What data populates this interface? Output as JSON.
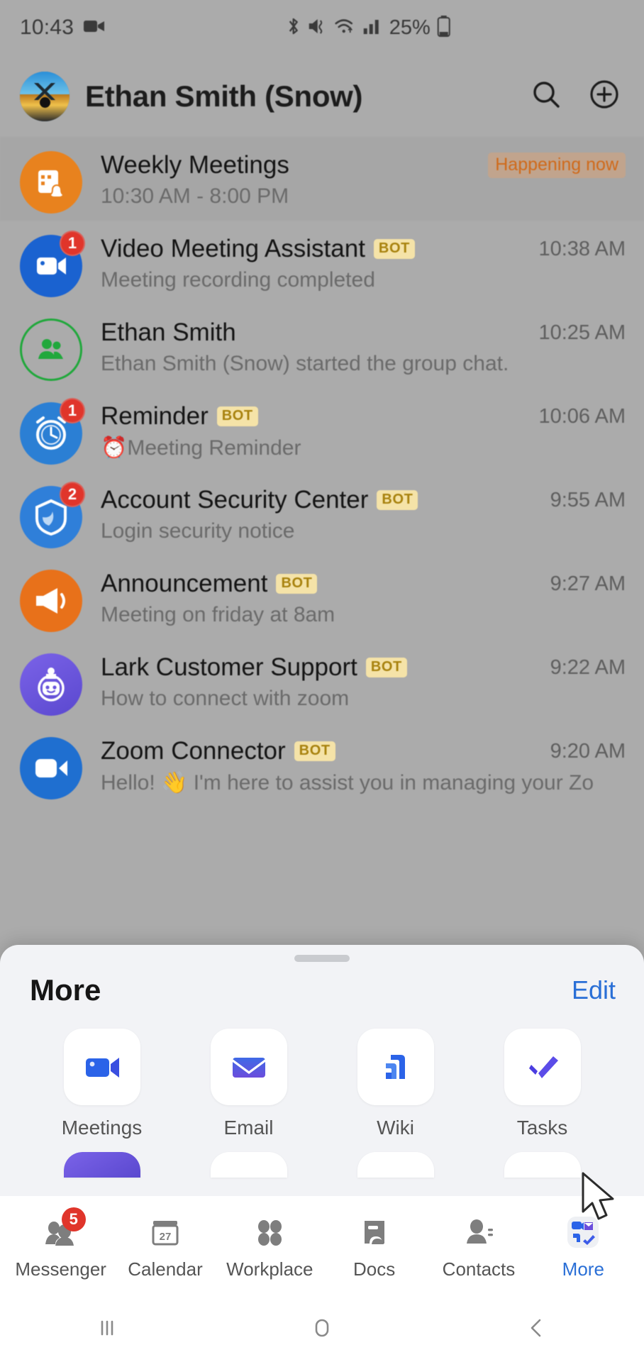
{
  "status_bar": {
    "time": "10:43",
    "battery_percent": "25%",
    "icons": [
      "screen-record-icon",
      "bluetooth-icon",
      "mute-vibrate-icon",
      "wifi-icon",
      "cellular-signal-icon",
      "battery-icon"
    ]
  },
  "header": {
    "title": "Ethan Smith (Snow)",
    "avatar_name": "user-avatar",
    "search_label": "search-icon",
    "add_label": "add-icon"
  },
  "chats": [
    {
      "name": "Weekly Meetings",
      "preview": "10:30 AM - 8:00 PM",
      "status": "Happening now",
      "time": "",
      "bot": false,
      "badge": "",
      "avatar": "calendar-bell-icon",
      "avatar_class": "orange",
      "highlight": true
    },
    {
      "name": "Video Meeting Assistant",
      "preview": "Meeting recording completed",
      "status": "",
      "time": "10:38 AM",
      "bot": true,
      "badge": "1",
      "avatar": "video-camera-icon",
      "avatar_class": "blue",
      "highlight": false
    },
    {
      "name": "Ethan Smith",
      "preview": "Ethan Smith (Snow) started the group chat.",
      "status": "",
      "time": "10:25 AM",
      "bot": false,
      "badge": "",
      "avatar": "group-people-icon",
      "avatar_class": "ring",
      "highlight": false
    },
    {
      "name": "Reminder",
      "preview": "⏰Meeting Reminder",
      "status": "",
      "time": "10:06 AM",
      "bot": true,
      "badge": "1",
      "avatar": "alarm-clock-icon",
      "avatar_class": "blue2",
      "highlight": false
    },
    {
      "name": "Account Security Center",
      "preview": "Login security notice",
      "status": "",
      "time": "9:55 AM",
      "bot": true,
      "badge": "2",
      "avatar": "shield-icon",
      "avatar_class": "blue3",
      "highlight": false
    },
    {
      "name": "Announcement",
      "preview": "Meeting on friday at 8am",
      "status": "",
      "time": "9:27 AM",
      "bot": true,
      "badge": "",
      "avatar": "megaphone-icon",
      "avatar_class": "orange2",
      "highlight": false
    },
    {
      "name": "Lark Customer Support",
      "preview": "How to connect with zoom",
      "status": "",
      "time": "9:22 AM",
      "bot": true,
      "badge": "",
      "avatar": "robot-icon",
      "avatar_class": "purple",
      "highlight": false
    },
    {
      "name": "Zoom Connector",
      "preview": "Hello! 👋 I'm here to assist you in managing your Zo",
      "status": "",
      "time": "9:20 AM",
      "bot": true,
      "badge": "",
      "avatar": "zoom-camera-icon",
      "avatar_class": "blue4",
      "highlight": false
    }
  ],
  "sheet": {
    "title": "More",
    "edit_label": "Edit",
    "apps": [
      {
        "label": "Meetings",
        "icon": "video-camera-icon"
      },
      {
        "label": "Email",
        "icon": "envelope-icon"
      },
      {
        "label": "Wiki",
        "icon": "wiki-icon"
      },
      {
        "label": "Tasks",
        "icon": "checkmark-icon"
      }
    ]
  },
  "tabbar": {
    "items": [
      {
        "label": "Messenger",
        "icon": "people-chat-icon",
        "badge": "5",
        "active": false
      },
      {
        "label": "Calendar",
        "icon": "calendar-icon",
        "badge": "",
        "active": false,
        "day": "27"
      },
      {
        "label": "Workplace",
        "icon": "grid-apps-icon",
        "badge": "",
        "active": false
      },
      {
        "label": "Docs",
        "icon": "docs-icon",
        "badge": "",
        "active": false
      },
      {
        "label": "Contacts",
        "icon": "contacts-icon",
        "badge": "",
        "active": false
      },
      {
        "label": "More",
        "icon": "more-apps-icon",
        "badge": "",
        "active": true
      }
    ]
  },
  "android_nav": {
    "recents": "recents-icon",
    "home": "home-icon",
    "back": "back-icon"
  },
  "colors": {
    "accent_blue": "#2a6fd6",
    "badge_red": "#e0352b",
    "bot_tag_bg": "#f5e3a8",
    "bot_tag_text": "#a8820e",
    "status_orange": "#cf6a1b"
  },
  "bot_tag_text": "BOT"
}
